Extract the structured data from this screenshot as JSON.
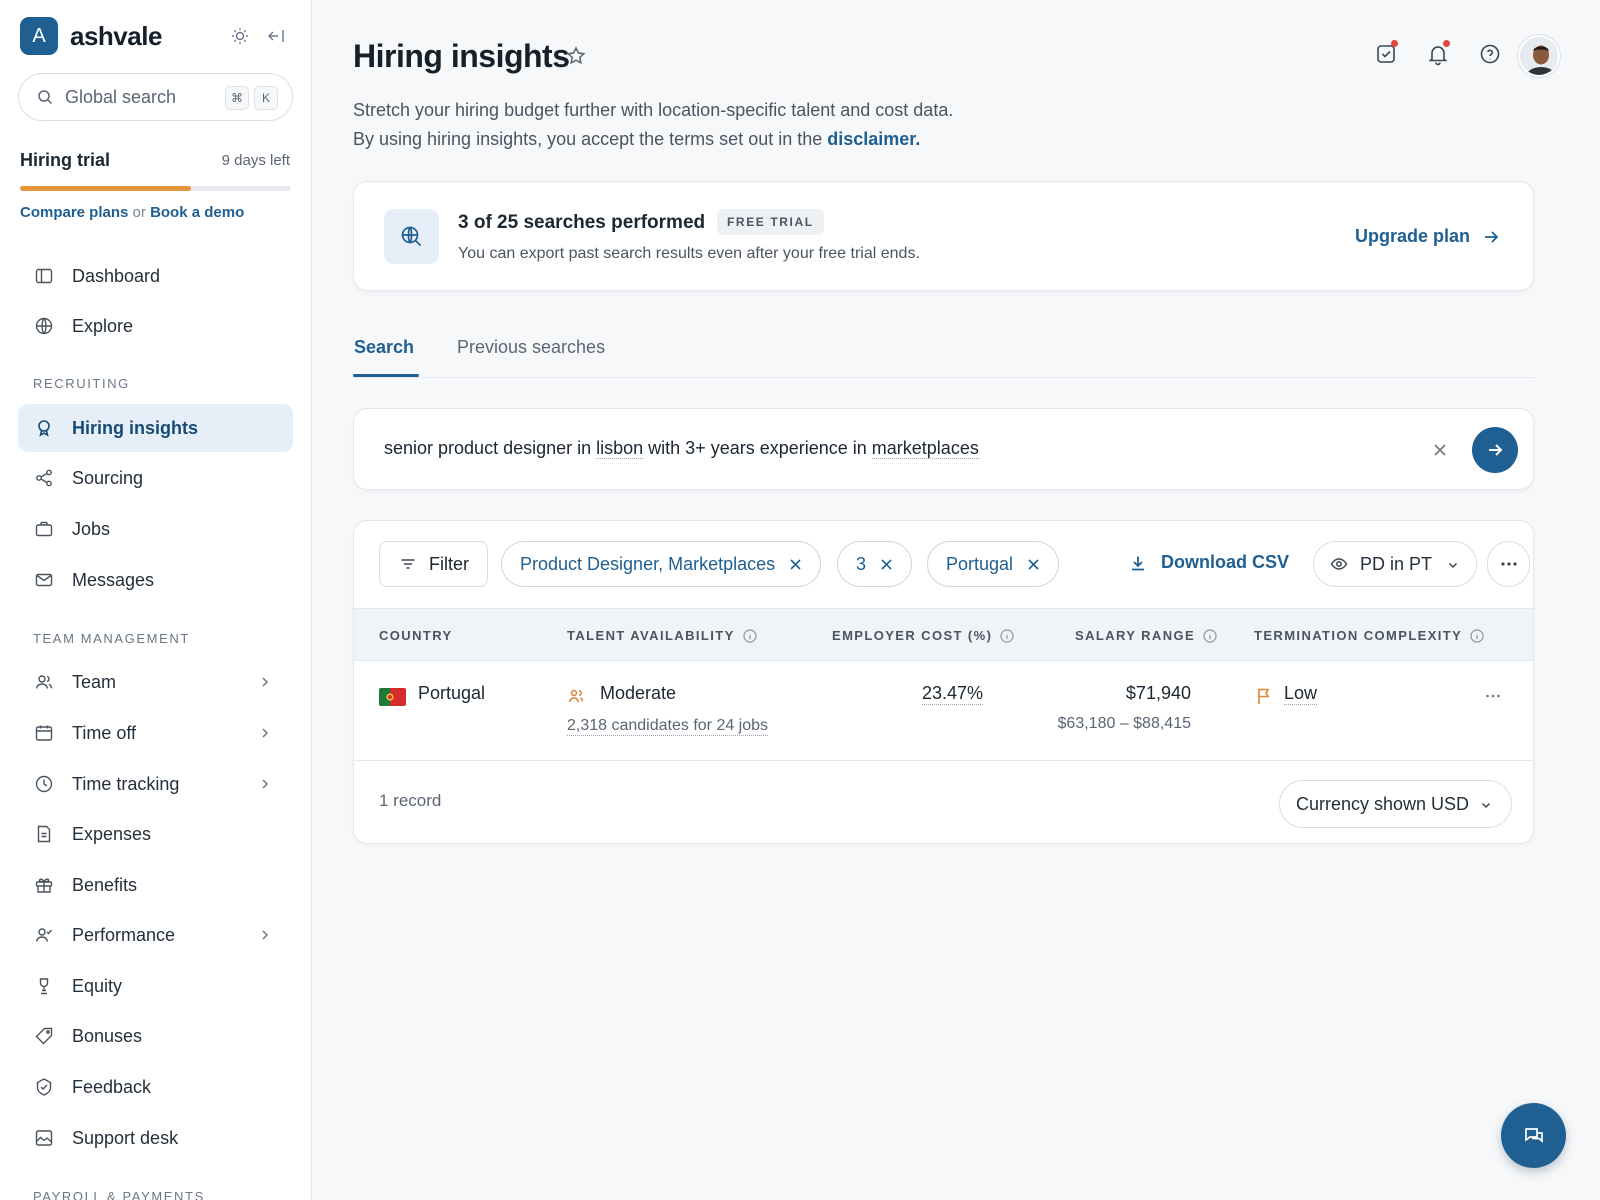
{
  "brand": {
    "initial": "A",
    "name": "ashvale"
  },
  "search": {
    "placeholder": "Global search",
    "shortcut_mod": "⌘",
    "shortcut_key": "K"
  },
  "trial": {
    "title": "Hiring trial",
    "days_left": "9 days left",
    "progress": 0.63,
    "compare_label": "Compare plans",
    "or_label": "or",
    "demo_label": "Book a demo",
    "progress_color": "#e3963b"
  },
  "nav": {
    "top": [
      {
        "label": "Dashboard",
        "icon": "sidebar-panel-icon"
      },
      {
        "label": "Explore",
        "icon": "globe-icon"
      }
    ],
    "recruiting_label": "RECRUITING",
    "recruiting": [
      {
        "label": "Hiring insights",
        "icon": "lightbulb-icon",
        "active": true
      },
      {
        "label": "Sourcing",
        "icon": "share-nodes-icon"
      },
      {
        "label": "Jobs",
        "icon": "briefcase-icon"
      },
      {
        "label": "Messages",
        "icon": "envelope-icon"
      }
    ],
    "team_label": "TEAM MANAGEMENT",
    "team": [
      {
        "label": "Team",
        "icon": "users-icon",
        "expandable": true
      },
      {
        "label": "Time off",
        "icon": "calendar-icon",
        "expandable": true
      },
      {
        "label": "Time tracking",
        "icon": "clock-icon",
        "expandable": true
      },
      {
        "label": "Expenses",
        "icon": "receipt-icon"
      },
      {
        "label": "Benefits",
        "icon": "gift-icon"
      },
      {
        "label": "Performance",
        "icon": "user-check-icon",
        "expandable": true
      },
      {
        "label": "Equity",
        "icon": "trophy-icon"
      },
      {
        "label": "Bonuses",
        "icon": "tag-icon"
      },
      {
        "label": "Feedback",
        "icon": "badge-check-icon"
      },
      {
        "label": "Support desk",
        "icon": "support-image-icon"
      }
    ],
    "payroll_label": "PAYROLL & PAYMENTS"
  },
  "header": {
    "title": "Hiring insights",
    "subtitle_line1": "Stretch your hiring budget further with location-specific talent and cost data.",
    "subtitle_line2": "By using hiring insights, you accept the terms set out in the",
    "disclaimer_link": "disclaimer."
  },
  "quota": {
    "title": "3 of 25 searches performed",
    "badge": "FREE TRIAL",
    "subtitle": "You can export past search results even after your free trial ends.",
    "upgrade_label": "Upgrade plan"
  },
  "tabs": [
    {
      "label": "Search",
      "active": true
    },
    {
      "label": "Previous searches",
      "active": false
    }
  ],
  "query": {
    "parts": [
      "senior product designer in ",
      "lisbon",
      " with 3+ years experience in ",
      "marketplaces"
    ]
  },
  "toolbar": {
    "filter_label": "Filter",
    "chips": [
      "Product Designer, Marketplaces",
      "3",
      "Portugal"
    ],
    "download_label": "Download CSV",
    "view_label": "PD in PT"
  },
  "table": {
    "columns": [
      "COUNTRY",
      "TALENT AVAILABILITY",
      "EMPLOYER COST (%)",
      "SALARY RANGE",
      "TERMINATION COMPLEXITY"
    ],
    "rows": [
      {
        "country": "Portugal",
        "availability": "Moderate",
        "candidates": "2,318 candidates for 24 jobs",
        "employer_cost": "23.47%",
        "salary": "$71,940",
        "salary_range": "$63,180 – $88,415",
        "termination": "Low"
      }
    ]
  },
  "footer": {
    "records": "1 record",
    "currency_label": "Currency shown USD"
  },
  "colors": {
    "accent": "#1f5f91",
    "accent_bg": "#e6eff7",
    "warning": "#e3963b",
    "notification": "#e0463b"
  }
}
